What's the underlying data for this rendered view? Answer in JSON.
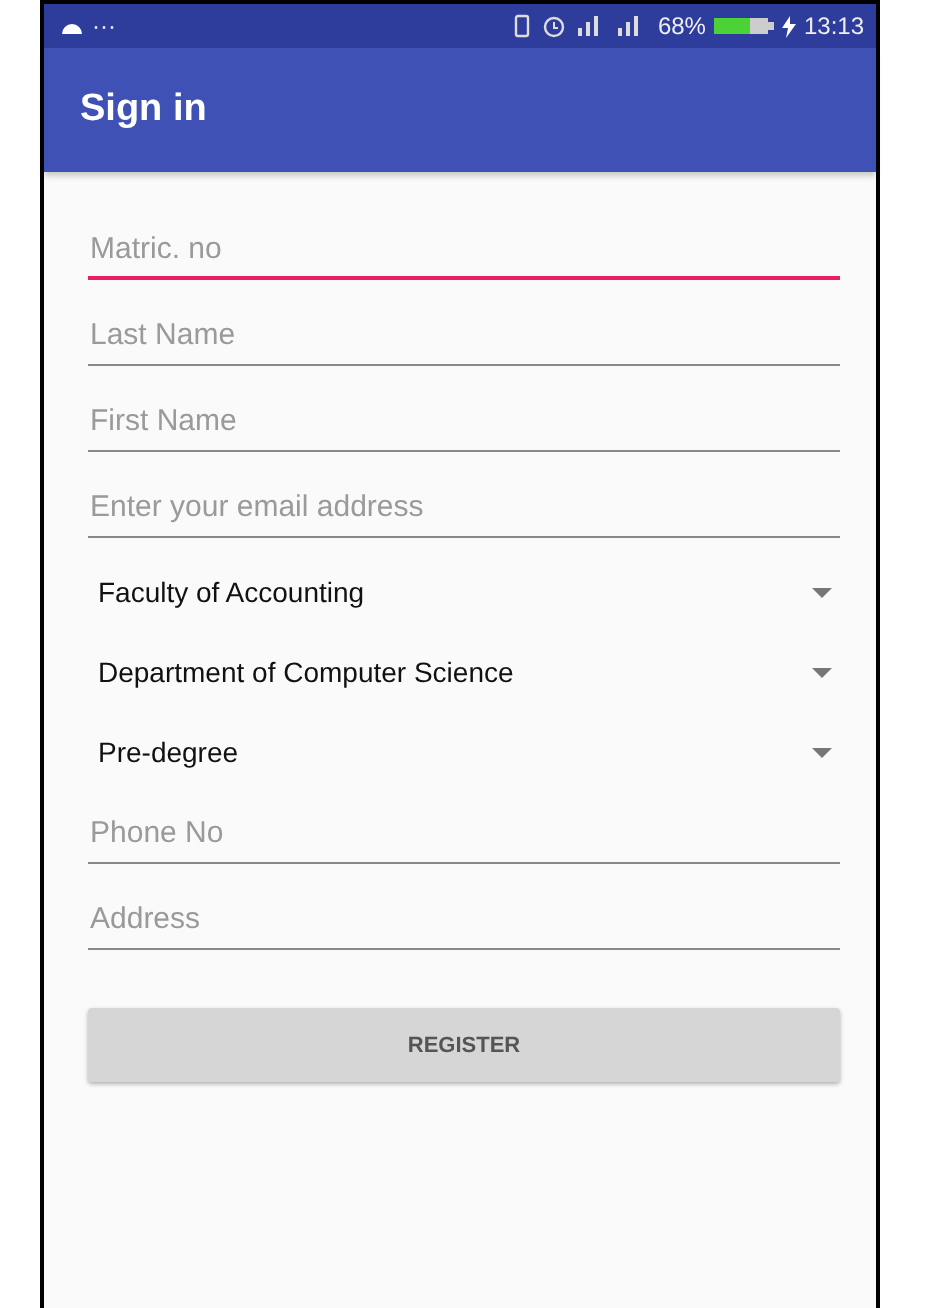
{
  "status_bar": {
    "dots": "···",
    "battery": "68%",
    "time": "13:13"
  },
  "app_bar": {
    "title": "Sign in"
  },
  "fields": [
    {
      "kind": "text",
      "placeholder": "Matric. no",
      "focused": true
    },
    {
      "kind": "text",
      "placeholder": "Last Name",
      "focused": false
    },
    {
      "kind": "text",
      "placeholder": "First Name",
      "focused": false
    },
    {
      "kind": "text",
      "placeholder": "Enter your email address",
      "focused": false
    },
    {
      "kind": "select",
      "value": "Faculty of Accounting"
    },
    {
      "kind": "select",
      "value": "Department of Computer Science"
    },
    {
      "kind": "select",
      "value": "Pre-degree"
    },
    {
      "kind": "text",
      "placeholder": "Phone No",
      "focused": false
    },
    {
      "kind": "text",
      "placeholder": "Address",
      "focused": false
    }
  ],
  "button": "REGISTER"
}
